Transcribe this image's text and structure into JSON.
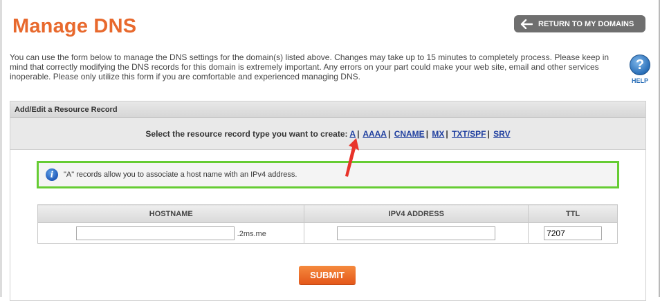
{
  "header": {
    "title": "Manage DNS",
    "return_label": "RETURN TO MY DOMAINS"
  },
  "intro_text": "You can use the form below to manage the DNS settings for the domain(s) listed above. Changes may take up to 15 minutes to completely process. Please keep in mind that correctly modifying the DNS records for this domain is extremely important. Any errors on your part could make your web site, email and other services inoperable. Please only utilize this form if you are comfortable and experienced managing DNS.",
  "help": {
    "label": "HELP",
    "icon": "question-icon"
  },
  "panel": {
    "title": "Add/Edit a Resource Record",
    "type_prompt": "Select the resource record type you want to create:",
    "types": [
      "A",
      "AAAA",
      "CNAME",
      "MX",
      "TXT/SPF",
      "SRV"
    ],
    "info_text": "\"A\" records allow you to associate a host name with an IPv4 address."
  },
  "table": {
    "headers": [
      "HOSTNAME",
      "IPV4 ADDRESS",
      "TTL"
    ],
    "hostname_value": "",
    "hostname_suffix": ".2ms.me",
    "ipv4_value": "",
    "ttl_value": "7207"
  },
  "submit_label": "SUBMIT",
  "colors": {
    "title": "#e8692d",
    "info_border": "#66cc33",
    "link": "#1f3f9f",
    "submit": "#e4571a",
    "annotation_arrow": "#e8332a"
  }
}
